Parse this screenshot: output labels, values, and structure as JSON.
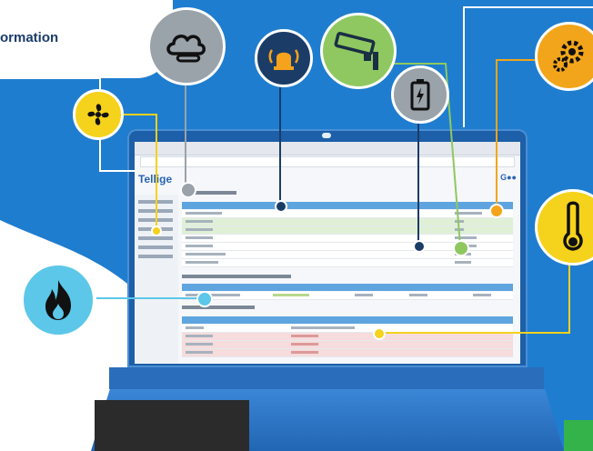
{
  "banner": {
    "heading": "ormation"
  },
  "screen": {
    "logo": "Tellige",
    "logo_right": "G●●"
  },
  "icons": {
    "fan": "fan-icon",
    "cloud": "cloud-icon",
    "alarm": "alarm-bell-icon",
    "camera": "security-camera-icon",
    "battery": "battery-icon",
    "settings": "gear-icon",
    "temperature": "thermometer-icon",
    "fire": "flame-icon"
  },
  "colors": {
    "background": "#1f7dcf",
    "yellow": "#f5d21c",
    "grey": "#9aa2aa",
    "green": "#8fc860",
    "orange": "#f2a51a",
    "cyan": "#5cc7e8",
    "white_rings": "#ffffff"
  }
}
